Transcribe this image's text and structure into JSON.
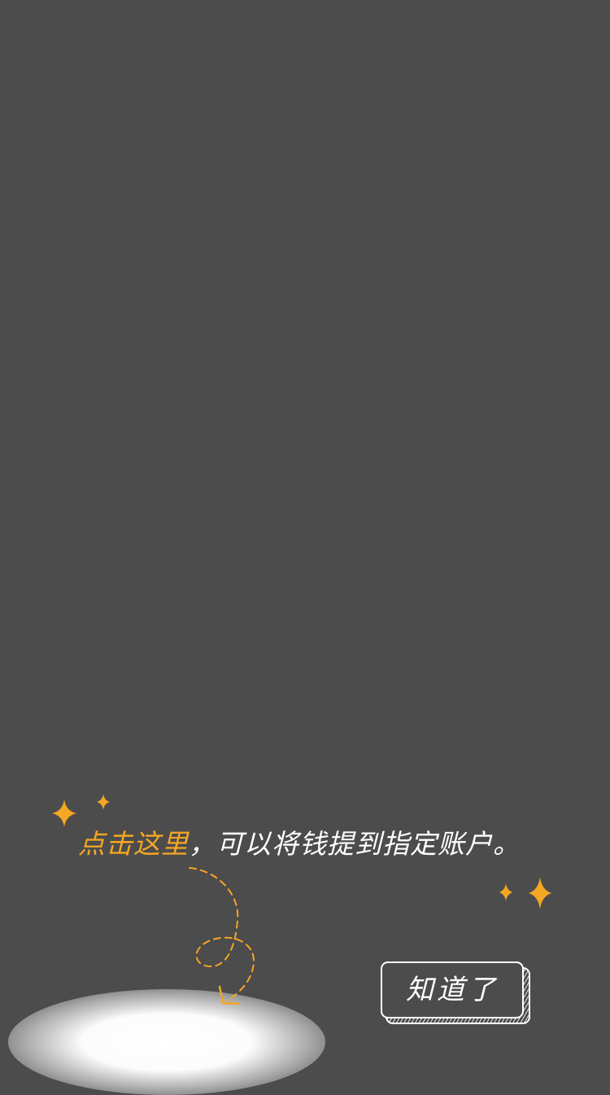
{
  "guide": {
    "highlight_text": "点击这里",
    "rest_text": "，可以将钱提到指定账户。",
    "dismiss_label": "知道了"
  },
  "colors": {
    "overlay": "#4c4c4c",
    "accent": "#f5a623",
    "text": "#ffffff"
  },
  "icons": {
    "sparkle": "sparkle-icon",
    "arrow": "dashed-curved-arrow-icon"
  }
}
